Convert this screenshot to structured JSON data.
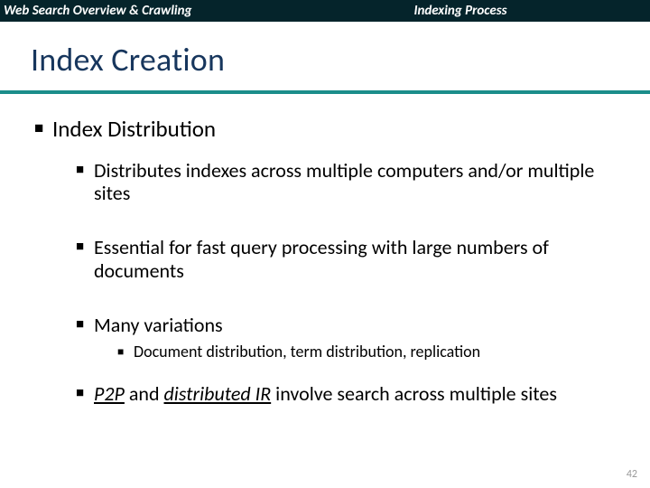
{
  "header": {
    "left": "Web Search Overview & Crawling",
    "right": "Indexing Process"
  },
  "title": "Index Creation",
  "bullets": {
    "l1": "Index Distribution",
    "l2a": "Distributes indexes across multiple computers and/or multiple sites",
    "l2b": "Essential for fast query processing with large numbers of documents",
    "l2c": "Many variations",
    "l3a": "Document distribution, term distribution, replication",
    "p2p": "P2P",
    "and": " and ",
    "dir": "distributed IR",
    "rest": " involve search across multiple sites"
  },
  "glyph": {
    "square": "■"
  },
  "page": "42"
}
